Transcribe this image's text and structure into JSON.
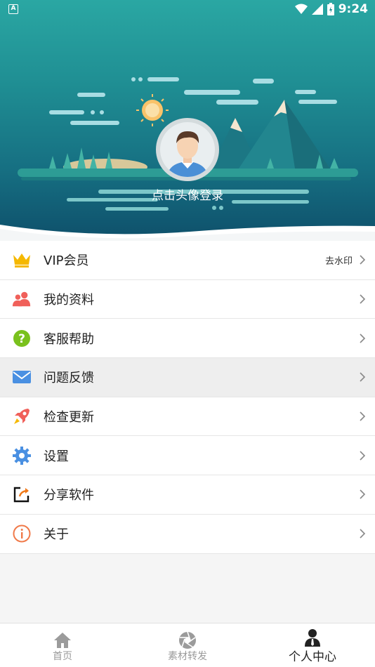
{
  "status_bar": {
    "time": "9:24",
    "app_icon_letter": "A"
  },
  "header": {
    "login_text": "点击头像登录"
  },
  "menu": {
    "items": [
      {
        "label": "VIP会员",
        "extra": "去水印",
        "icon": "crown-icon"
      },
      {
        "label": "我的资料",
        "icon": "users-icon"
      },
      {
        "label": "客服帮助",
        "icon": "help-icon"
      },
      {
        "label": "问题反馈",
        "icon": "mail-icon"
      },
      {
        "label": "检查更新",
        "icon": "rocket-icon"
      },
      {
        "label": "设置",
        "icon": "gear-icon"
      },
      {
        "label": "分享软件",
        "icon": "share-icon"
      },
      {
        "label": "关于",
        "icon": "info-icon"
      }
    ]
  },
  "bottom_nav": {
    "items": [
      {
        "label": "首页",
        "icon": "home-icon"
      },
      {
        "label": "素材转发",
        "icon": "aperture-icon"
      },
      {
        "label": "个人中心",
        "icon": "person-icon"
      }
    ],
    "active_index": 2
  },
  "colors": {
    "header_top": "#2aa7a3",
    "header_bottom": "#0e4f6a",
    "crown": "#f5b800",
    "users": "#f0605a",
    "help": "#7ac11d",
    "mail": "#4a90e2",
    "gear": "#4a90e2",
    "info": "#f07a4a"
  }
}
